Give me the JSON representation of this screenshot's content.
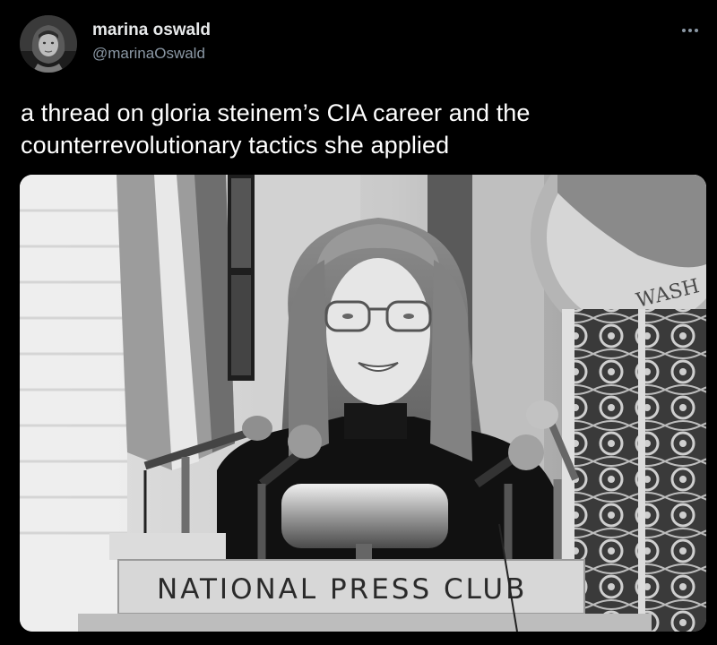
{
  "author": {
    "display_name": "marina oswald",
    "handle": "@marinaOswald"
  },
  "tweet": {
    "text": "a thread on gloria steinem’s CIA career and the counterrevolutionary tactics she applied"
  },
  "photo": {
    "placard_text": "NATIONAL PRESS CLUB",
    "seal_text": "WASH"
  },
  "icons": {
    "more": "more-horizontal-icon",
    "avatar": "avatar-portrait"
  },
  "colors": {
    "background": "#000000",
    "name": "#e7e9ea",
    "handle": "#8b98a5",
    "text": "#ffffff"
  }
}
